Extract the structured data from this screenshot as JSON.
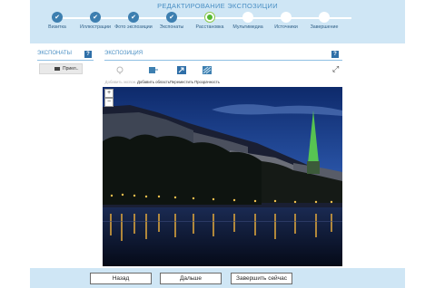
{
  "header": {
    "title": "РЕДАКТИРОВАНИЕ ЭКСПОЗИЦИИ"
  },
  "steps": [
    {
      "label": "Визитка",
      "state": "done"
    },
    {
      "label": "Иллюстрации",
      "state": "done"
    },
    {
      "label": "Фото экспозиции",
      "state": "done"
    },
    {
      "label": "Экспонаты",
      "state": "done"
    },
    {
      "label": "Расстановка",
      "state": "current"
    },
    {
      "label": "Мультимедиа",
      "state": "future"
    },
    {
      "label": "Источники",
      "state": "future"
    },
    {
      "label": "Завершение",
      "state": "future"
    }
  ],
  "left_panel": {
    "title": "ЭКСПОНАТЫ",
    "help": "?",
    "items": [
      {
        "label": "Приел.."
      }
    ]
  },
  "right_panel": {
    "title": "ЭКСПОЗИЦИЯ",
    "help": "?"
  },
  "toolbar": {
    "add_exhibit": "Добавить экспон.",
    "add_area": "Добавить область",
    "move_front": "Переместить",
    "transparency": "Прозрачность"
  },
  "zoom": {
    "in": "+",
    "out": "−"
  },
  "footer": {
    "back": "Назад",
    "next": "Дальше",
    "finish": "Завершить сейчас"
  },
  "colors": {
    "accent": "#4a8fc4",
    "header_bg": "#cfe6f5",
    "step_done": "#3d7fb0",
    "step_current": "#55b832",
    "highlight": "#5dd24a"
  }
}
